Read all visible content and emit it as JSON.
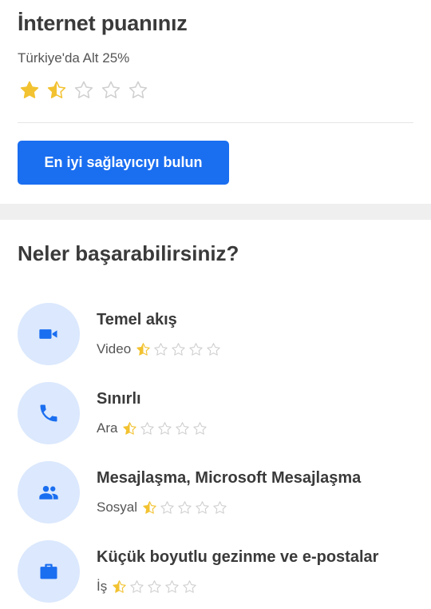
{
  "rating": {
    "title": "İnternet puanınız",
    "subtitle": "Türkiye'da Alt 25%",
    "stars": 1.5,
    "max_stars": 5
  },
  "cta": {
    "label": "En iyi sağlayıcıyı bulun"
  },
  "section": {
    "title": "Neler başarabilirsiniz?",
    "items": [
      {
        "icon": "video-camera-icon",
        "title": "Temel akış",
        "category": "Video",
        "stars": 0.5
      },
      {
        "icon": "phone-icon",
        "title": "Sınırlı",
        "category": "Ara",
        "stars": 0.5
      },
      {
        "icon": "people-icon",
        "title": "Mesajlaşma, Microsoft Mesajlaşma",
        "category": "Sosyal",
        "stars": 0.5
      },
      {
        "icon": "briefcase-icon",
        "title": "Küçük boyutlu gezinme ve e-postalar",
        "category": "İş",
        "stars": 0.5
      }
    ]
  },
  "colors": {
    "accent": "#1a6ef0",
    "star_fill": "#f2c230",
    "star_empty": "#cfcfcf",
    "icon_bg": "#dbe8fd"
  }
}
